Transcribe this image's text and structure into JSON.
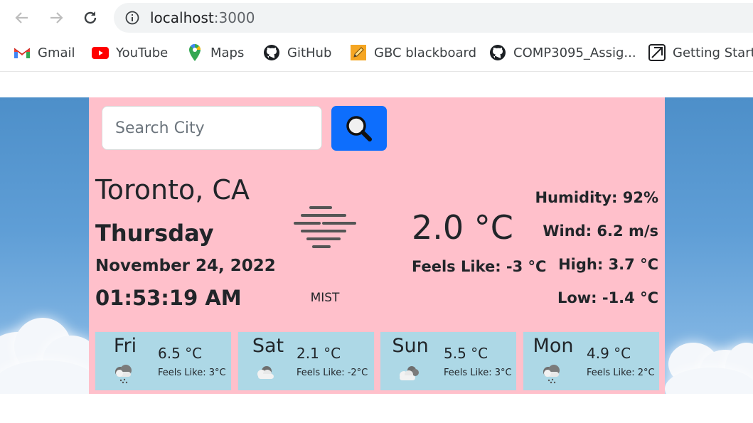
{
  "browser": {
    "url_host": "localhost",
    "url_port": ":3000",
    "bookmarks": [
      "Gmail",
      "YouTube",
      "Maps",
      "GitHub",
      "GBC blackboard",
      "COMP3095_Assig...",
      "Getting Starte"
    ]
  },
  "search": {
    "placeholder": "Search City"
  },
  "current": {
    "city": "Toronto, CA",
    "day": "Thursday",
    "date": "November 24, 2022",
    "time": "01:53:19 AM",
    "condition": "MIST",
    "temp": "2.0 °C",
    "feels_like": "Feels Like: -3 °C",
    "humidity": "Humidity: 92%",
    "wind": "Wind: 6.2 m/s",
    "high": "High: 3.7 °C",
    "low": "Low: -1.4 °C"
  },
  "forecast": [
    {
      "day": "Fri",
      "temp": "6.5 °C",
      "feels": "Feels Like: 3°C",
      "icon": "rain-cloud-icon"
    },
    {
      "day": "Sat",
      "temp": "2.1 °C",
      "feels": "Feels Like: -2°C",
      "icon": "cloud-icon"
    },
    {
      "day": "Sun",
      "temp": "5.5 °C",
      "feels": "Feels Like: 3°C",
      "icon": "clouds-icon"
    },
    {
      "day": "Mon",
      "temp": "4.9 °C",
      "feels": "Feels Like: 2°C",
      "icon": "rain-cloud-icon"
    }
  ],
  "colors": {
    "card_bg": "#ffc0cb",
    "forecast_bg": "#add8e6",
    "search_button": "#0d6efd"
  }
}
